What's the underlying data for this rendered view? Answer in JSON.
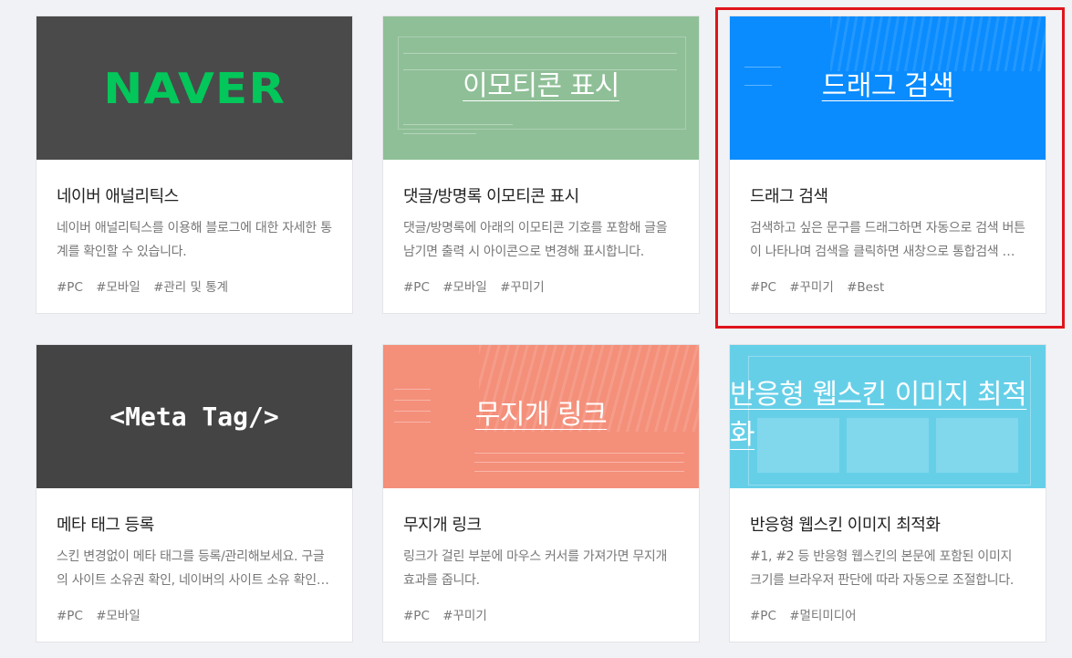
{
  "cards": [
    {
      "thumb_text": "NAVER",
      "thumb_color": "#4a4a4a",
      "title": "네이버 애널리틱스",
      "desc": "네이버 애널리틱스를 이용해 블로그에 대한 자세한 통계를 확인할 수 있습니다.",
      "tags": [
        "#PC",
        "#모바일",
        "#관리 및 통계"
      ]
    },
    {
      "thumb_text": "이모티콘 표시",
      "thumb_color": "#8fbf97",
      "title": "댓글/방명록 이모티콘 표시",
      "desc": "댓글/방명록에 아래의 이모티콘 기호를 포함해 글을 남기면 출력 시 아이콘으로 변경해 표시합니다.",
      "tags": [
        "#PC",
        "#모바일",
        "#꾸미기"
      ]
    },
    {
      "thumb_text": "드래그 검색",
      "thumb_color": "#0a8cff",
      "title": "드래그 검색",
      "desc": "검색하고 싶은 문구를 드래그하면 자동으로 검색 버튼이 나타나며 검색을 클릭하면 새창으로 통합검색 결과를 보여줍니다.",
      "tags": [
        "#PC",
        "#꾸미기",
        "#Best"
      ]
    },
    {
      "thumb_text": "<Meta Tag/>",
      "thumb_color": "#444444",
      "title": "메타 태그 등록",
      "desc": "스킨 변경없이 메타 태그를 등록/관리해보세요. 구글의 사이트 소유권 확인, 네이버의 사이트 소유 확인 등에 활용할 수 있습니다.",
      "tags": [
        "#PC",
        "#모바일"
      ]
    },
    {
      "thumb_text": "무지개 링크",
      "thumb_color": "#f48f7a",
      "title": "무지개 링크",
      "desc": "링크가 걸린 부분에 마우스 커서를 가져가면 무지개 효과를 줍니다.",
      "tags": [
        "#PC",
        "#꾸미기"
      ]
    },
    {
      "thumb_text": "반응형 웹스킨 이미지 최적화",
      "thumb_color": "#66cfe8",
      "title": "반응형 웹스킨 이미지 최적화",
      "desc": "#1, #2 등 반응형 웹스킨의 본문에 포함된 이미지 크기를 브라우저 판단에 따라 자동으로 조절합니다.",
      "tags": [
        "#PC",
        "#멀티미디어"
      ]
    }
  ],
  "highlight_color": "#e0151c"
}
